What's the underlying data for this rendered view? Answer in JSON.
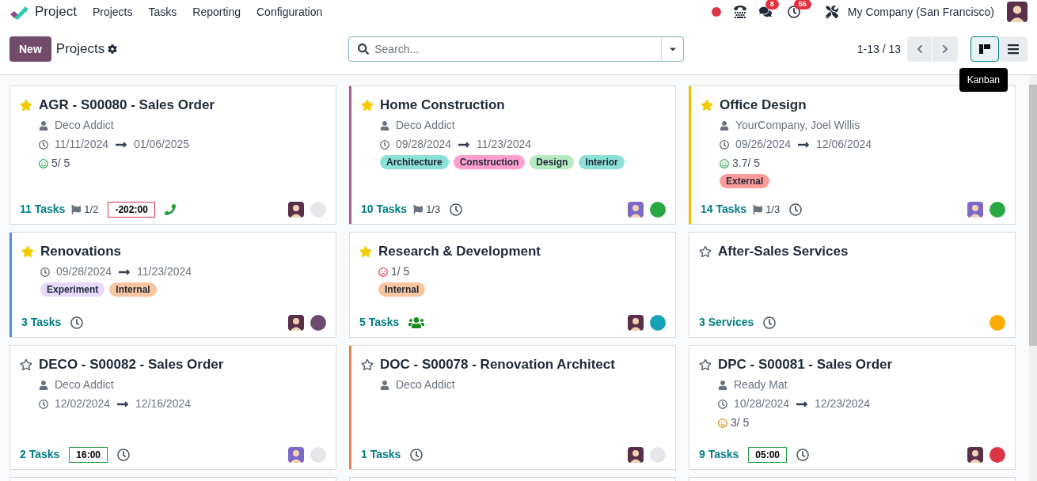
{
  "navbar": {
    "app_name": "Project",
    "menu": [
      "Projects",
      "Tasks",
      "Reporting",
      "Configuration"
    ],
    "messages_badge": "8",
    "activities_badge": "55",
    "company": "My Company (San Francisco)"
  },
  "control_panel": {
    "new_button": "New",
    "breadcrumb": "Projects",
    "search": {
      "placeholder": "Search..."
    },
    "pager": "1-13 / 13",
    "views": [
      {
        "kind": "kanban",
        "selected": true
      },
      {
        "kind": "list",
        "selected": false
      }
    ],
    "tooltip": "Kanban"
  },
  "cards": [
    {
      "title": "AGR - S00080 - Sales Order",
      "favorite": true,
      "customer": "Deco Addict",
      "start": "11/11/2024",
      "end": "01/06/2025",
      "rating": {
        "kind": "happy",
        "text": "5/ 5"
      },
      "count": "11 Tasks",
      "milestones": "1/2",
      "time": {
        "text": "-202:00",
        "kind": "overdue"
      },
      "activity": {
        "kind": "phone"
      },
      "avatar": {
        "kind": "glasses"
      },
      "status": {
        "color": "#e5e7eb"
      }
    },
    {
      "title": "Home Construction",
      "favorite": true,
      "accent": {
        "color": "#a0628f"
      },
      "customer": "Deco Addict",
      "start": "09/28/2024",
      "end": "11/23/2024",
      "tags": [
        {
          "label": "Architecture",
          "color": "#8ce0d8"
        },
        {
          "label": "Construction",
          "color": "#ff9fce"
        },
        {
          "label": "Design",
          "color": "#b6ebc1"
        },
        {
          "label": "Interior",
          "color": "#8ce0d8"
        }
      ],
      "count": "10 Tasks",
      "milestones": "1/3",
      "activity": {
        "kind": "clock"
      },
      "avatar": {
        "kind": "beard"
      },
      "status": {
        "color": "#28a745"
      }
    },
    {
      "title": "Office Design",
      "favorite": true,
      "accent": {
        "color": "#f0bc00"
      },
      "customer": "YourCompany, Joel Willis",
      "start": "09/26/2024",
      "end": "12/06/2024",
      "rating": {
        "kind": "happy",
        "text": "3.7/ 5"
      },
      "tags": [
        {
          "label": "External",
          "color": "#ff9c99"
        }
      ],
      "count": "14 Tasks",
      "milestones": "1/3",
      "activity": {
        "kind": "clock"
      },
      "avatar": {
        "kind": "beard"
      },
      "status": {
        "color": "#28a745"
      }
    },
    {
      "title": "Renovations",
      "favorite": true,
      "accent": {
        "color": "#5b8ee6"
      },
      "start": "09/28/2024",
      "end": "11/23/2024",
      "tags": [
        {
          "label": "Experiment",
          "color": "#e6d9fb"
        },
        {
          "label": "Internal",
          "color": "#f7c59f"
        }
      ],
      "count": "3 Tasks",
      "activity": {
        "kind": "clock"
      },
      "avatar": {
        "kind": "glasses"
      },
      "status": {
        "color": "#6d4b6e"
      }
    },
    {
      "title": "Research & Development",
      "favorite": true,
      "rating": {
        "kind": "sad",
        "text": "1/ 5"
      },
      "tags": [
        {
          "label": "Internal",
          "color": "#f7c59f"
        }
      ],
      "count": "5 Tasks",
      "activity": {
        "kind": "people"
      },
      "avatar": {
        "kind": "glasses"
      },
      "status": {
        "color": "#17a2b8"
      }
    },
    {
      "title": "After-Sales Services",
      "favorite": false,
      "count": "3 Services",
      "activity": {
        "kind": "clock"
      },
      "status": {
        "color": "#ffac00"
      }
    },
    {
      "title": "DECO - S00082 - Sales Order",
      "favorite": false,
      "customer": "Deco Addict",
      "start": "12/02/2024",
      "end": "12/16/2024",
      "count": "2 Tasks",
      "time": {
        "text": "16:00",
        "kind": "ok"
      },
      "activity": {
        "kind": "clock"
      },
      "avatar": {
        "kind": "beard"
      },
      "status": {
        "color": "#e5e7eb"
      }
    },
    {
      "title": "DOC - S00078 - Renovation Architect",
      "favorite": false,
      "accent": {
        "color": "#e08350"
      },
      "customer": "Deco Addict",
      "count": "1 Tasks",
      "activity": {
        "kind": "clock"
      },
      "avatar": {
        "kind": "glasses"
      },
      "status": {
        "color": "#e5e7eb"
      }
    },
    {
      "title": "DPC - S00081 - Sales Order",
      "favorite": false,
      "customer": "Ready Mat",
      "start": "10/28/2024",
      "end": "12/23/2024",
      "rating": {
        "kind": "neutral",
        "text": "3/ 5"
      },
      "count": "9 Tasks",
      "time": {
        "text": "05:00",
        "kind": "ok"
      },
      "activity": {
        "kind": "clock"
      },
      "avatar": {
        "kind": "glasses"
      },
      "status": {
        "color": "#dc3545"
      }
    }
  ]
}
